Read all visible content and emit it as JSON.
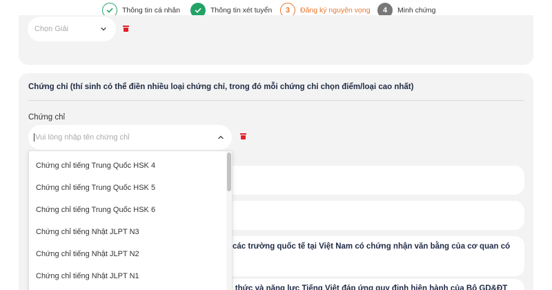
{
  "stepper": {
    "steps": [
      {
        "label": "Thông tin cá nhân",
        "marker": "check",
        "state": "done"
      },
      {
        "label": "Thông tin xét tuyển",
        "marker": "check",
        "state": "done"
      },
      {
        "label": "Đăng ký nguyện vọng",
        "marker": "3",
        "state": "active"
      },
      {
        "label": "Minh chứng",
        "marker": "4",
        "state": "pending"
      }
    ]
  },
  "award": {
    "placeholder": "Chọn Giải"
  },
  "certificate_section": {
    "title": "Chứng chỉ (thí sinh có thể điền nhiều loại chứng chỉ, trong đó mỗi chứng chỉ chọn điểm/loại cao nhất)",
    "field_label": "Chứng chỉ",
    "input_placeholder": "Vui lòng nhập tên chứng chỉ",
    "options": [
      "Chứng chỉ tiếng Trung Quốc HSK 4",
      "Chứng chỉ tiếng Trung Quốc HSK 5",
      "Chứng chỉ tiếng Trung Quốc HSK 6",
      "Chứng chỉ tiếng Nhật JLPT N3",
      "Chứng chỉ tiếng Nhật JLPT N2",
      "Chứng chỉ tiếng Nhật JLPT N1"
    ]
  },
  "background_rows": {
    "row3_line1": "ặc các trường quốc tế tại Việt Nam có chứng nhận văn bằng của cơ quan có",
    "row3_line2": "",
    "row4_line1": "iến thức và năng lực Tiếng Việt đáp ứng quy định hiện hành của Bộ GD&ĐT"
  },
  "colors": {
    "success": "#22a365",
    "active": "#e8742a",
    "pending": "#777777",
    "delete": "#e0202a",
    "card_bg": "#f3f3f3"
  }
}
